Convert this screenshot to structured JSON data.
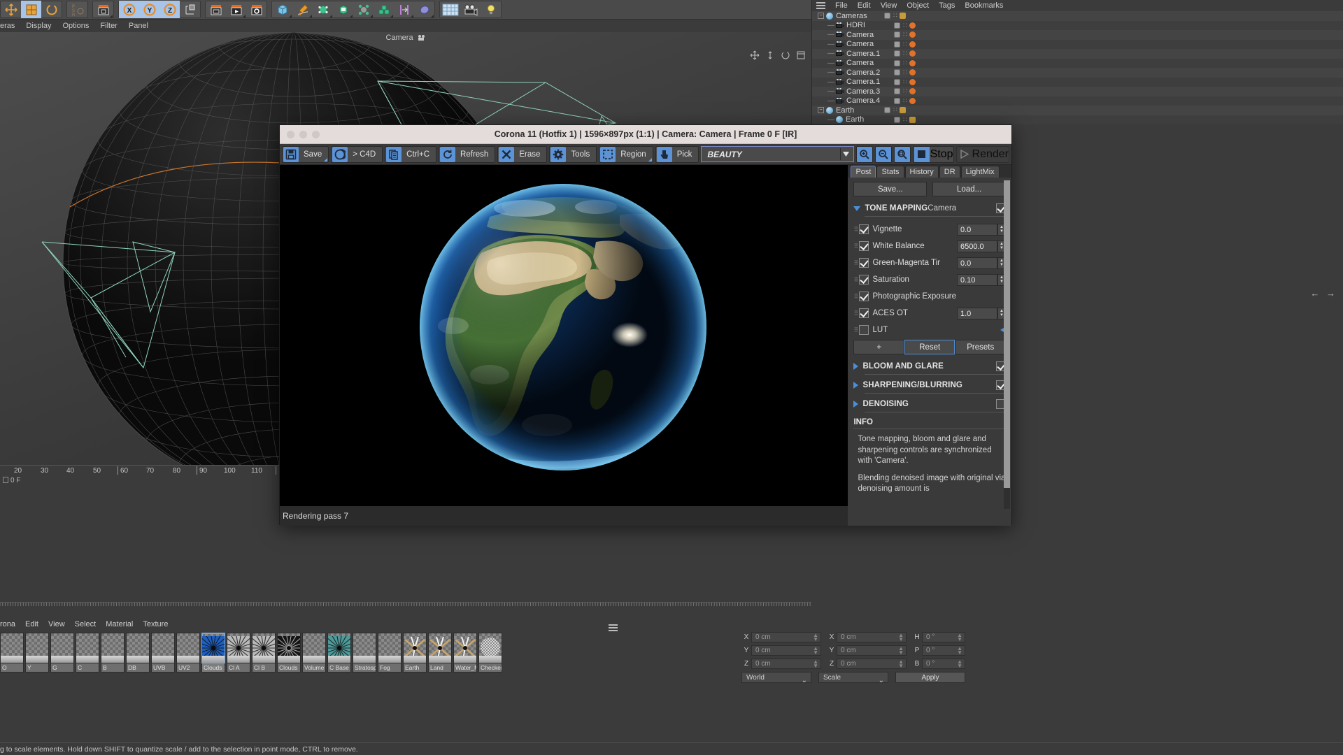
{
  "app": {
    "viewport_label": "Camera",
    "menu2": [
      "eras",
      "Display",
      "Options",
      "Filter",
      "Panel"
    ],
    "frame_label": "0 F",
    "ruler_ticks": [
      "20",
      "30",
      "40",
      "50",
      "60",
      "70",
      "80",
      "90",
      "100",
      "110"
    ],
    "status_text": "g to scale elements. Hold down SHIFT to quantize scale / add to the selection in point mode, CTRL to remove."
  },
  "object_manager": {
    "menu": [
      "File",
      "Edit",
      "View",
      "Object",
      "Tags",
      "Bookmarks"
    ],
    "items": [
      {
        "label": "Cameras",
        "icon": "sphere-icon",
        "depth": 0
      },
      {
        "label": "HDRI",
        "icon": "camera-icon",
        "depth": 1
      },
      {
        "label": "Camera",
        "icon": "camera-icon",
        "depth": 1
      },
      {
        "label": "Camera",
        "icon": "camera-icon",
        "depth": 1
      },
      {
        "label": "Camera.1",
        "icon": "camera-icon",
        "depth": 1
      },
      {
        "label": "Camera",
        "icon": "camera-icon",
        "depth": 1
      },
      {
        "label": "Camera.2",
        "icon": "camera-icon",
        "depth": 1
      },
      {
        "label": "Camera.1",
        "icon": "camera-icon",
        "depth": 1
      },
      {
        "label": "Camera.3",
        "icon": "camera-icon",
        "depth": 1
      },
      {
        "label": "Camera.4",
        "icon": "camera-icon",
        "depth": 1
      },
      {
        "label": "Earth",
        "icon": "sphere-icon",
        "depth": 0
      },
      {
        "label": "Earth",
        "icon": "sphere-icon",
        "depth": 1
      }
    ]
  },
  "materials": {
    "menu": [
      "rona",
      "Edit",
      "View",
      "Select",
      "Material",
      "Texture"
    ],
    "items": [
      {
        "label": "O",
        "kind": "empty"
      },
      {
        "label": "Y",
        "kind": "empty"
      },
      {
        "label": "G",
        "kind": "empty"
      },
      {
        "label": "C",
        "kind": "empty"
      },
      {
        "label": "B",
        "kind": "empty"
      },
      {
        "label": "DB",
        "kind": "empty"
      },
      {
        "label": "UVB",
        "kind": "empty"
      },
      {
        "label": "UV2",
        "kind": "empty"
      },
      {
        "label": "Clouds :",
        "kind": "blue",
        "selected": true
      },
      {
        "label": "Cl A",
        "kind": "grey"
      },
      {
        "label": "Cl B",
        "kind": "grey"
      },
      {
        "label": "Clouds",
        "kind": "dark"
      },
      {
        "label": "Volume",
        "kind": "empty"
      },
      {
        "label": "C Base",
        "kind": "teal"
      },
      {
        "label": "Stratosp",
        "kind": "empty"
      },
      {
        "label": "Fog",
        "kind": "empty"
      },
      {
        "label": "Earth",
        "kind": "earth"
      },
      {
        "label": "Land",
        "kind": "earth"
      },
      {
        "label": "Water_M",
        "kind": "earth"
      },
      {
        "label": "Checker",
        "kind": "checkerball"
      }
    ]
  },
  "coordinates": {
    "rows": [
      {
        "axis": "X",
        "pos": "0 cm",
        "size": "0 cm",
        "rot_axis": "H",
        "rot": "0 °"
      },
      {
        "axis": "Y",
        "pos": "0 cm",
        "size": "0 cm",
        "rot_axis": "P",
        "rot": "0 °"
      },
      {
        "axis": "Z",
        "pos": "0 cm",
        "size": "0 cm",
        "rot_axis": "B",
        "rot": "0 °"
      }
    ],
    "space": "World",
    "mode": "Scale",
    "apply": "Apply"
  },
  "vfb": {
    "title": "Corona 11 (Hotfix 1) | 1596×897px (1:1) | Camera: Camera | Frame 0 F [IR]",
    "toolbar": [
      {
        "label": "Save",
        "icon": "floppy-icon",
        "dropdown": true
      },
      {
        "label": "> C4D",
        "icon": "corona-icon",
        "dropdown": false
      },
      {
        "label": "Ctrl+C",
        "icon": "copy-icon",
        "dropdown": false
      },
      {
        "label": "Refresh",
        "icon": "refresh-icon",
        "dropdown": false
      },
      {
        "label": "Erase",
        "icon": "erase-icon",
        "dropdown": false
      },
      {
        "label": "Tools",
        "icon": "gear-icon",
        "dropdown": false
      },
      {
        "label": "Region",
        "icon": "region-icon",
        "dropdown": true
      },
      {
        "label": "Pick",
        "icon": "pick-icon",
        "dropdown": false
      }
    ],
    "pass_select": "BEAUTY",
    "zoom_buttons": [
      "zoom-in-icon",
      "zoom-out-icon",
      "zoom-fit-icon"
    ],
    "stop_label": "Stop",
    "render_label": "Render",
    "status": "Rendering pass 7",
    "tabs": [
      {
        "label": "Post",
        "active": true
      },
      {
        "label": "Stats",
        "active": false
      },
      {
        "label": "History",
        "active": false
      },
      {
        "label": "DR",
        "active": false
      },
      {
        "label": "LightMix",
        "active": false
      }
    ],
    "post": {
      "save_label": "Save...",
      "load_label": "Load...",
      "tone_mapping_title": "TONE MAPPING",
      "tone_mapping_sub": "Camera",
      "tone_mapping_enabled": true,
      "params": [
        {
          "label": "Vignette",
          "checked": true,
          "value": "0.0",
          "has_field": true
        },
        {
          "label": "White Balance",
          "checked": true,
          "value": "6500.0",
          "has_field": true
        },
        {
          "label": "Green-Magenta Tir",
          "checked": true,
          "value": "0.0",
          "has_field": true
        },
        {
          "label": "Saturation",
          "checked": true,
          "value": "0.10",
          "has_field": true
        },
        {
          "label": "Photographic Exposure",
          "checked": true,
          "value": "",
          "has_field": false
        },
        {
          "label": "ACES OT",
          "checked": true,
          "value": "1.0",
          "has_field": true
        },
        {
          "label": "LUT",
          "checked": false,
          "value": "",
          "has_field": false
        }
      ],
      "add_label": "+",
      "reset_label": "Reset",
      "presets_label": "Presets",
      "sections": [
        {
          "label": "BLOOM AND GLARE",
          "checked": true
        },
        {
          "label": "SHARPENING/BLURRING",
          "checked": true
        },
        {
          "label": "DENOISING",
          "checked": false
        }
      ],
      "info_header": "INFO",
      "info_paragraphs": [
        "Tone mapping, bloom and glare and sharpening controls are synchronized with 'Camera'.",
        "Blending denoised image with original via denoising amount is"
      ]
    }
  },
  "colors": {
    "accent_blue": "#5b93d6",
    "tri_blue": "#4a90d9",
    "panel_bg": "#3a3a3a",
    "titlebar": "#e3dcda",
    "c4d_bg": "#3b3b3b"
  }
}
